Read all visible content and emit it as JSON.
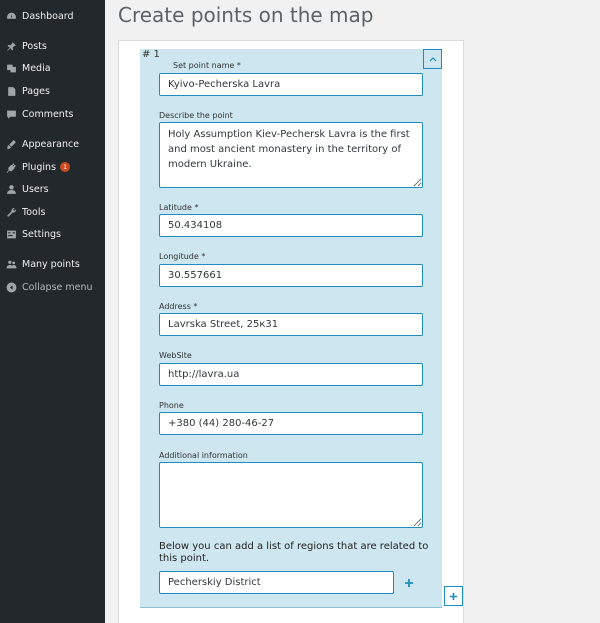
{
  "sidebar": {
    "items": [
      {
        "label": "Dashboard",
        "icon": "dashboard-icon"
      },
      {
        "label": "Posts",
        "icon": "pin-icon"
      },
      {
        "label": "Media",
        "icon": "media-icon"
      },
      {
        "label": "Pages",
        "icon": "page-icon"
      },
      {
        "label": "Comments",
        "icon": "comment-icon"
      },
      {
        "label": "Appearance",
        "icon": "brush-icon"
      },
      {
        "label": "Plugins",
        "icon": "plug-icon",
        "badge": "1"
      },
      {
        "label": "Users",
        "icon": "user-icon"
      },
      {
        "label": "Tools",
        "icon": "wrench-icon"
      },
      {
        "label": "Settings",
        "icon": "settings-icon"
      },
      {
        "label": "Many points",
        "icon": "users-icon"
      },
      {
        "label": "Collapse menu",
        "icon": "collapse-icon"
      }
    ]
  },
  "page": {
    "title": "Create points on the map"
  },
  "point": {
    "number": "# 1",
    "name_label": "Set point name *",
    "name_value": "Kyivo-Pecherska Lavra",
    "describe_label": "Describe the point",
    "describe_value": "Holy Assumption Kiev-Pechersk Lavra is the first and most ancient monastery in the territory of modern Ukraine.",
    "latitude_label": "Latitude *",
    "latitude_value": "50.434108",
    "longitude_label": "Longitude *",
    "longitude_value": "30.557661",
    "address_label": "Address *",
    "address_value": "Lavrska Street, 25к31",
    "website_label": "WebSite",
    "website_value": "http://lavra.ua",
    "phone_label": "Phone",
    "phone_value": "+380 (44) 280-46-27",
    "additional_label": "Additional information",
    "additional_value": "",
    "regions_note": "Below you can add a list of regions that are related to this point.",
    "region_value": "Pecherskiy District"
  },
  "colors": {
    "sidebar_bg": "#23282d",
    "panel_bg": "#cde6f0",
    "accent": "#1e8cbe",
    "badge": "#ca4a1f"
  }
}
